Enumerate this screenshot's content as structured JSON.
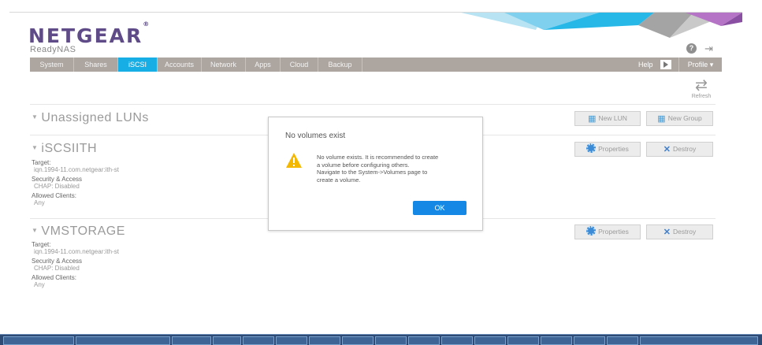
{
  "brand": {
    "logo": "NETGEAR",
    "logo_mark": "®",
    "product": "ReadyNAS"
  },
  "header_icons": {
    "help": "help-circle-icon",
    "logout": "logout-icon"
  },
  "nav": {
    "items": [
      "System",
      "Shares",
      "iSCSI",
      "Accounts",
      "Network",
      "Apps",
      "Cloud",
      "Backup"
    ],
    "active": "iSCSI",
    "help": "Help",
    "profile": "Profile ▾"
  },
  "toolbar": {
    "refresh_label": "Refresh"
  },
  "sections": {
    "unassigned": {
      "title": "Unassigned LUNs",
      "new_lun": "New LUN",
      "new_group": "New Group"
    },
    "iscsiith": {
      "title": "iSCSIITH",
      "target_label": "Target:",
      "target_value": "iqn.1994-11.com.netgear:ith-st",
      "security_label": "Security & Access",
      "security_value": "CHAP: Disabled",
      "clients_label": "Allowed Clients:",
      "clients_value": "Any",
      "properties": "Properties",
      "destroy": "Destroy"
    },
    "vmstorage": {
      "title": "VMSTORAGE",
      "target_label": "Target:",
      "target_value": "iqn.1994-11.com.netgear:ith-st",
      "security_label": "Security & Access",
      "security_value": "CHAP: Disabled",
      "clients_label": "Allowed Clients:",
      "clients_value": "Any",
      "properties": "Properties",
      "destroy": "Destroy"
    }
  },
  "dialog": {
    "title": "No volumes exist",
    "line1": "No volume exists. It is recommended to create",
    "line2": "a volume before configuring others.",
    "line3": "Navigate to the System->Volumes page to",
    "line4": "create a volume.",
    "ok": "OK"
  },
  "colors": {
    "brand": "#5e4b87",
    "nav_bg": "#ada6a0",
    "nav_active": "#17aee6",
    "ok_button": "#1588e6",
    "warning": "#f5b800"
  }
}
